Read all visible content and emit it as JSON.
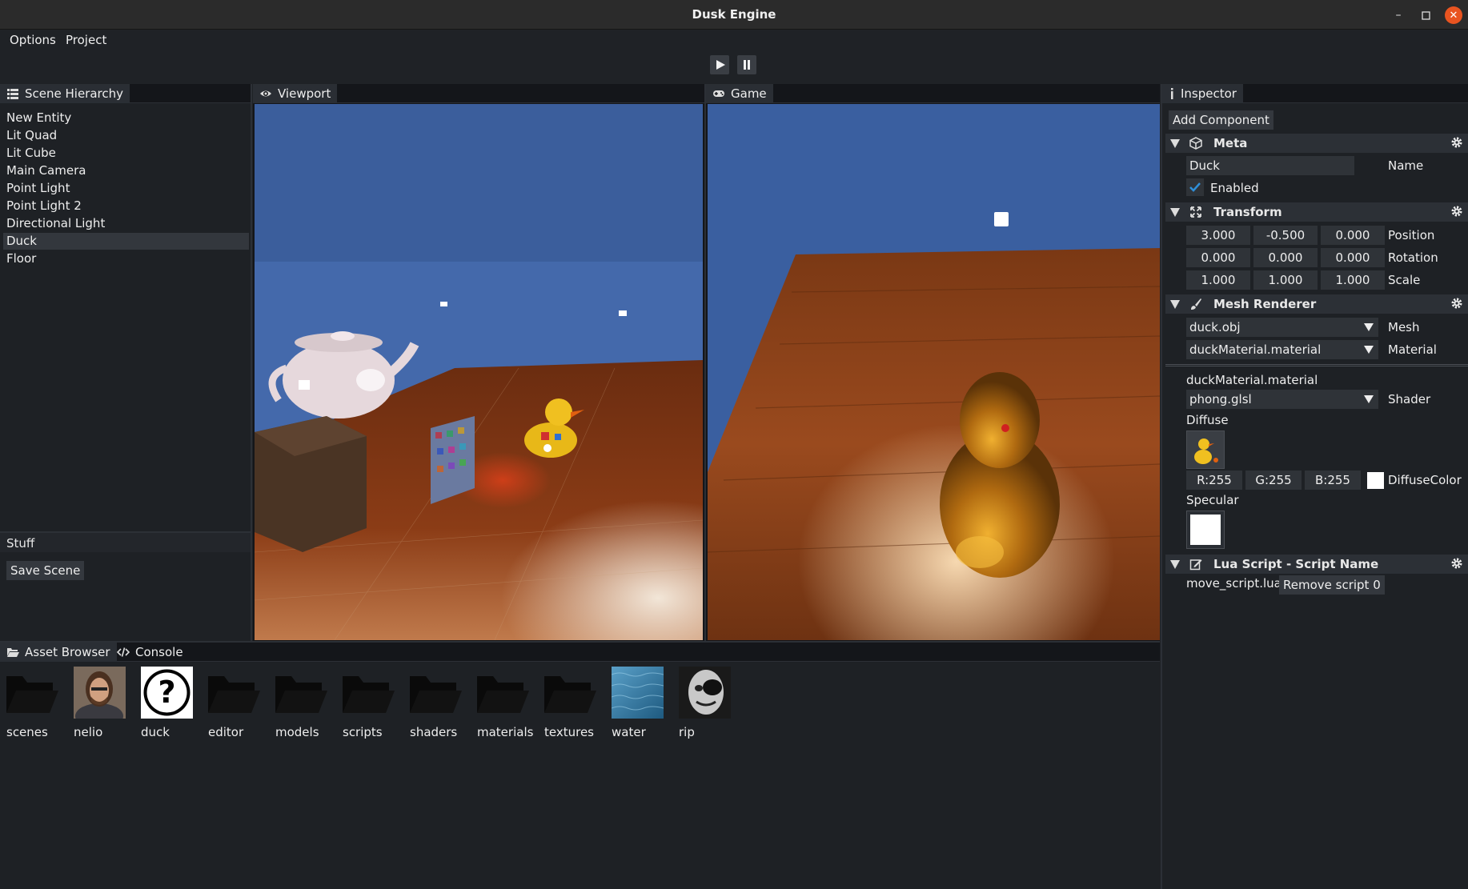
{
  "window": {
    "title": "Dusk Engine",
    "min_label": "–",
    "max_label": "☐",
    "close_label": "✕"
  },
  "menu": {
    "items": [
      "Options",
      "Project"
    ]
  },
  "toolbar": {
    "play_label": "Play",
    "pause_label": "Pause"
  },
  "hierarchy": {
    "tab_label": "Scene Hierarchy",
    "items": [
      "New Entity",
      "Lit Quad",
      "Lit Cube",
      "Main Camera",
      "Point Light",
      "Point Light 2",
      "Directional Light",
      "Duck",
      "Floor"
    ],
    "selected": "Duck"
  },
  "stuff": {
    "header": "Stuff",
    "save_label": "Save Scene"
  },
  "viewport": {
    "tab_label": "Viewport"
  },
  "game": {
    "tab_label": "Game"
  },
  "inspector": {
    "tab_label": "Inspector",
    "add_component_label": "Add Component",
    "meta": {
      "title": "Meta",
      "name_value": "Duck",
      "name_label": "Name",
      "enabled_label": "Enabled"
    },
    "transform": {
      "title": "Transform",
      "position": [
        "3.000",
        "-0.500",
        "0.000"
      ],
      "position_label": "Position",
      "rotation": [
        "0.000",
        "0.000",
        "0.000"
      ],
      "rotation_label": "Rotation",
      "scale": [
        "1.000",
        "1.000",
        "1.000"
      ],
      "scale_label": "Scale"
    },
    "mesh_renderer": {
      "title": "Mesh Renderer",
      "mesh_value": "duck.obj",
      "mesh_label": "Mesh",
      "material_value": "duckMaterial.material",
      "material_label": "Material",
      "material_name": "duckMaterial.material",
      "shader_value": "phong.glsl",
      "shader_label": "Shader",
      "diffuse_label": "Diffuse",
      "r": "R:255",
      "g": "G:255",
      "b": "B:255",
      "diffuse_color_label": "DiffuseColor",
      "specular_label": "Specular"
    },
    "lua": {
      "title": "Lua Script - Script Name",
      "script_file": "move_script.lua",
      "remove_label": "Remove script 0"
    }
  },
  "assets": {
    "tab_label": "Asset Browser",
    "console_label": "Console",
    "items": [
      {
        "name": "scenes",
        "kind": "folder-icon"
      },
      {
        "name": "nelio",
        "kind": "photo"
      },
      {
        "name": "duck",
        "kind": "question-icon"
      },
      {
        "name": "editor",
        "kind": "folder-icon"
      },
      {
        "name": "models",
        "kind": "folder-icon"
      },
      {
        "name": "scripts",
        "kind": "folder-icon"
      },
      {
        "name": "shaders",
        "kind": "folder-icon"
      },
      {
        "name": "materials",
        "kind": "folder-icon"
      },
      {
        "name": "textures",
        "kind": "folder-icon"
      },
      {
        "name": "water",
        "kind": "water-texture"
      },
      {
        "name": "rip",
        "kind": "photo"
      }
    ]
  },
  "colors": {
    "accent_close": "#e95420",
    "check": "#2f8fd8",
    "sky": "#3a5fa0",
    "wood": "#9a4a1e"
  }
}
